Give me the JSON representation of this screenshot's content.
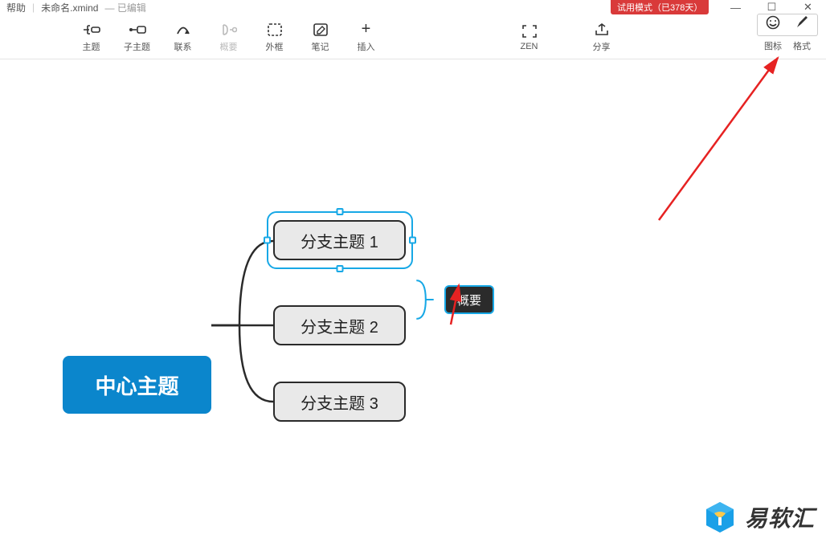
{
  "titlebar": {
    "help": "帮助",
    "filename": "未命名.xmind",
    "edited": "— 已编辑",
    "trial": "试用模式（已378天）"
  },
  "wincontrols": {
    "min": "—",
    "max": "☐",
    "close": "✕"
  },
  "toolbar": {
    "topic": "主题",
    "subtopic": "子主题",
    "relation": "联系",
    "summary": "概要",
    "boundary": "外框",
    "note": "笔记",
    "insert": "插入",
    "zen": "ZEN",
    "share": "分享",
    "icons": "图标",
    "format": "格式"
  },
  "mindmap": {
    "center": "中心主题",
    "branch1": "分支主题 1",
    "branch2": "分支主题 2",
    "branch3": "分支主题 3",
    "summary": "概要"
  },
  "watermark": {
    "text": "易软汇"
  }
}
